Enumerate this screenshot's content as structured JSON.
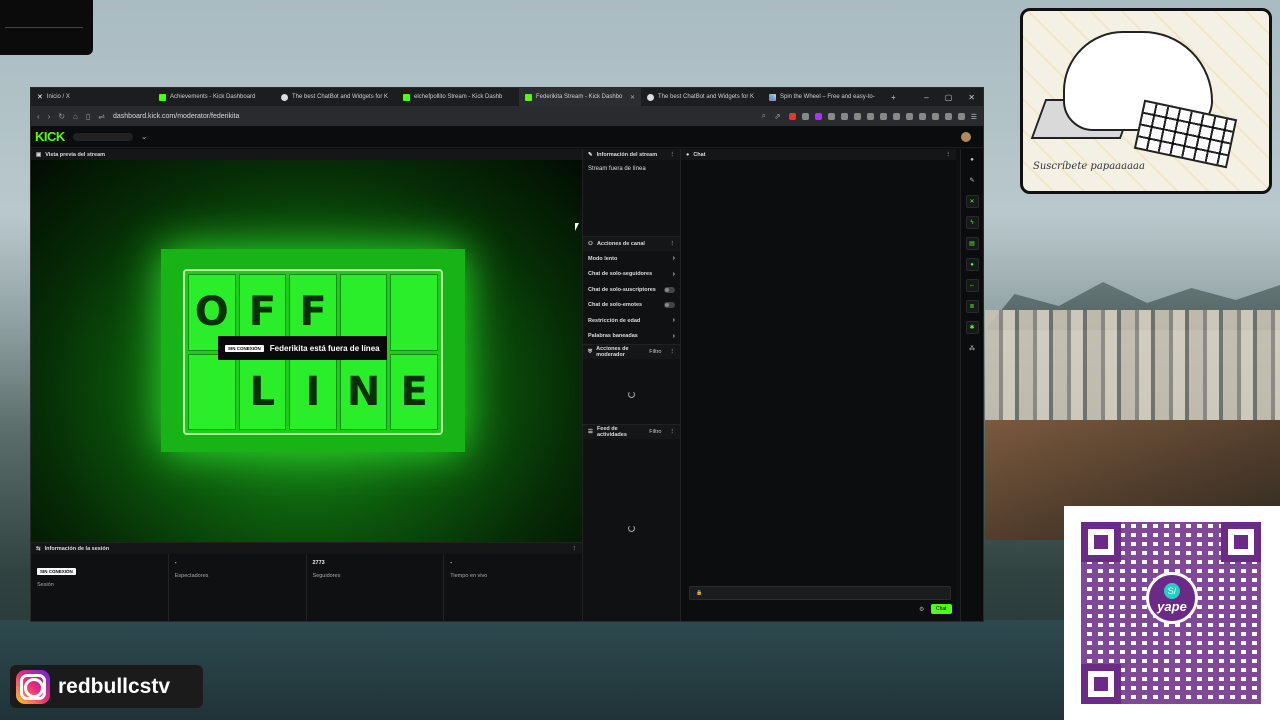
{
  "browser": {
    "tabs": [
      {
        "title": "Inicio / X",
        "active": false
      },
      {
        "title": "Achievements - Kick Dashboard",
        "active": false
      },
      {
        "title": "The best ChatBot and Widgets for K",
        "active": false
      },
      {
        "title": "elchefpollito Stream - Kick Dashb",
        "active": false
      },
      {
        "title": "Federikita Stream - Kick Dashbo",
        "active": true
      },
      {
        "title": "The best ChatBot and Widgets for K",
        "active": false
      },
      {
        "title": "Spin the Wheel – Free and easy-to-",
        "active": false
      }
    ],
    "new_tab": "+",
    "url": "dashboard.kick.com/moderator/federikita"
  },
  "kick": {
    "logo": "KICK",
    "preview": {
      "header": "Vista previa del stream",
      "offline_top": [
        "O",
        "F",
        "F",
        "",
        ""
      ],
      "offline_bottom": [
        "",
        "L",
        "I",
        "N",
        "E"
      ],
      "badge": "SIN CONEXIÓN",
      "status_text": "Federikita está fuera de línea"
    },
    "session": {
      "header": "Información de la sesión",
      "stats": [
        {
          "value": "SIN CONEXIÓN",
          "label": "Sesión"
        },
        {
          "value": "-",
          "label": "Espectadores"
        },
        {
          "value": "2773",
          "label": "Seguidores"
        },
        {
          "value": "-",
          "label": "Tiempo en vivo"
        }
      ]
    },
    "stream_info": {
      "header": "Información del stream",
      "body": "Stream fuera de línea"
    },
    "channel_actions": {
      "header": "Acciones de canal",
      "items": [
        {
          "label": "Modo lento",
          "type": "arrow"
        },
        {
          "label": "Chat de solo-seguidores",
          "type": "arrow"
        },
        {
          "label": "Chat de solo-suscriptores",
          "type": "toggle"
        },
        {
          "label": "Chat de solo-emotes",
          "type": "toggle"
        },
        {
          "label": "Restricción de edad",
          "type": "arrow"
        },
        {
          "label": "Palabras baneadas",
          "type": "arrow"
        }
      ]
    },
    "mod_actions": {
      "header": "Acciones de moderador",
      "filter": "Filtro"
    },
    "activity_feed": {
      "header": "Feed de actividades",
      "filter": "Filtro"
    },
    "chat": {
      "header": "Chat",
      "send_label": "Chat"
    }
  },
  "overlays": {
    "instagram_handle": "redbullcstv",
    "yape_logo": "yape",
    "meme_signature": "Suscríbete papaaaaaa"
  },
  "colors": {
    "kick_green": "#53fc18",
    "yape_purple": "#6b2a86"
  }
}
